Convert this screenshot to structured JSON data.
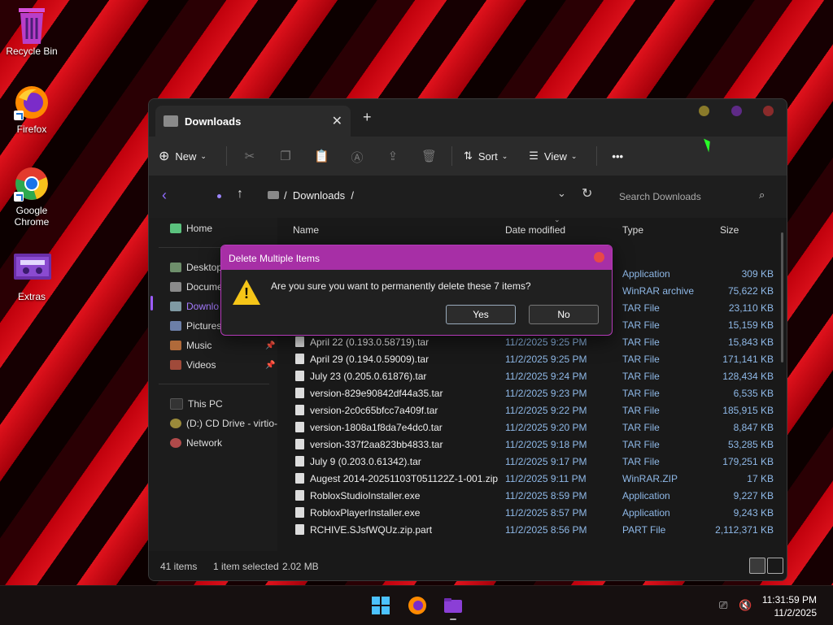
{
  "desktop": {
    "icons": [
      {
        "label": "Recycle Bin",
        "icon": "recycle-bin-icon"
      },
      {
        "label": "Firefox",
        "icon": "firefox-icon"
      },
      {
        "label": "Google Chrome",
        "icon": "chrome-icon"
      },
      {
        "label": "Extras",
        "icon": "fortnite-folder-icon"
      }
    ]
  },
  "window": {
    "tab_title": "Downloads",
    "toolbar": {
      "new_label": "New",
      "sort_label": "Sort",
      "view_label": "View",
      "more_label": "•••"
    },
    "address": {
      "sep1": "/",
      "crumb": "Downloads",
      "sep2": "/",
      "search_placeholder": "Search Downloads"
    },
    "nav": {
      "home": "Home",
      "desktop": "Desktop",
      "documents": "Docume",
      "downloads": "Downlo",
      "pictures": "Pictures",
      "music": "Music",
      "videos": "Videos",
      "this_pc": "This PC",
      "cd_drive": "(D:) CD Drive - virtio-",
      "network": "Network"
    },
    "columns": {
      "name": "Name",
      "date": "Date modified",
      "type": "Type",
      "size": "Size"
    },
    "rows": [
      {
        "name": "",
        "date": "",
        "type": "Application",
        "size": "309 KB"
      },
      {
        "name": "",
        "date": "",
        "type": "WinRAR archive",
        "size": "75,622 KB"
      },
      {
        "name": "",
        "date": "",
        "type": "TAR File",
        "size": "23,110 KB"
      },
      {
        "name": "",
        "date": "",
        "type": "TAR File",
        "size": "15,159 KB"
      },
      {
        "name": "April 22 (0.193.0.58719).tar",
        "date": "11/2/2025 9:25 PM",
        "type": "TAR File",
        "size": "15,843 KB"
      },
      {
        "name": "April 29 (0.194.0.59009).tar",
        "date": "11/2/2025 9:25 PM",
        "type": "TAR File",
        "size": "171,141 KB"
      },
      {
        "name": "July 23 (0.205.0.61876).tar",
        "date": "11/2/2025 9:24 PM",
        "type": "TAR File",
        "size": "128,434 KB"
      },
      {
        "name": "version-829e90842df44a35.tar",
        "date": "11/2/2025 9:23 PM",
        "type": "TAR File",
        "size": "6,535 KB"
      },
      {
        "name": "version-2c0c65bfcc7a409f.tar",
        "date": "11/2/2025 9:22 PM",
        "type": "TAR File",
        "size": "185,915 KB"
      },
      {
        "name": "version-1808a1f8da7e4dc0.tar",
        "date": "11/2/2025 9:20 PM",
        "type": "TAR File",
        "size": "8,847 KB"
      },
      {
        "name": "version-337f2aa823bb4833.tar",
        "date": "11/2/2025 9:18 PM",
        "type": "TAR File",
        "size": "53,285 KB"
      },
      {
        "name": "July 9 (0.203.0.61342).tar",
        "date": "11/2/2025 9:17 PM",
        "type": "TAR File",
        "size": "179,251 KB"
      },
      {
        "name": "Augest 2014-20251103T051122Z-1-001.zip",
        "date": "11/2/2025 9:11 PM",
        "type": "WinRAR.ZIP",
        "size": "17 KB"
      },
      {
        "name": "RobloxStudioInstaller.exe",
        "date": "11/2/2025 8:59 PM",
        "type": "Application",
        "size": "9,227 KB"
      },
      {
        "name": "RobloxPlayerInstaller.exe",
        "date": "11/2/2025 8:57 PM",
        "type": "Application",
        "size": "9,243 KB"
      },
      {
        "name": "RCHIVE.SJsfWQUz.zip.part",
        "date": "11/2/2025 8:56 PM",
        "type": "PART File",
        "size": "2,112,371 KB"
      }
    ],
    "status": {
      "count": "41 items",
      "selected": "1 item selected",
      "size": "2.02 MB"
    }
  },
  "dialog": {
    "title": "Delete Multiple Items",
    "message": "Are you sure you want to permanently delete these 7 items?",
    "yes": "Yes",
    "no": "No"
  },
  "taskbar": {
    "time": "11:31:59 PM",
    "date": "11/2/2025"
  }
}
